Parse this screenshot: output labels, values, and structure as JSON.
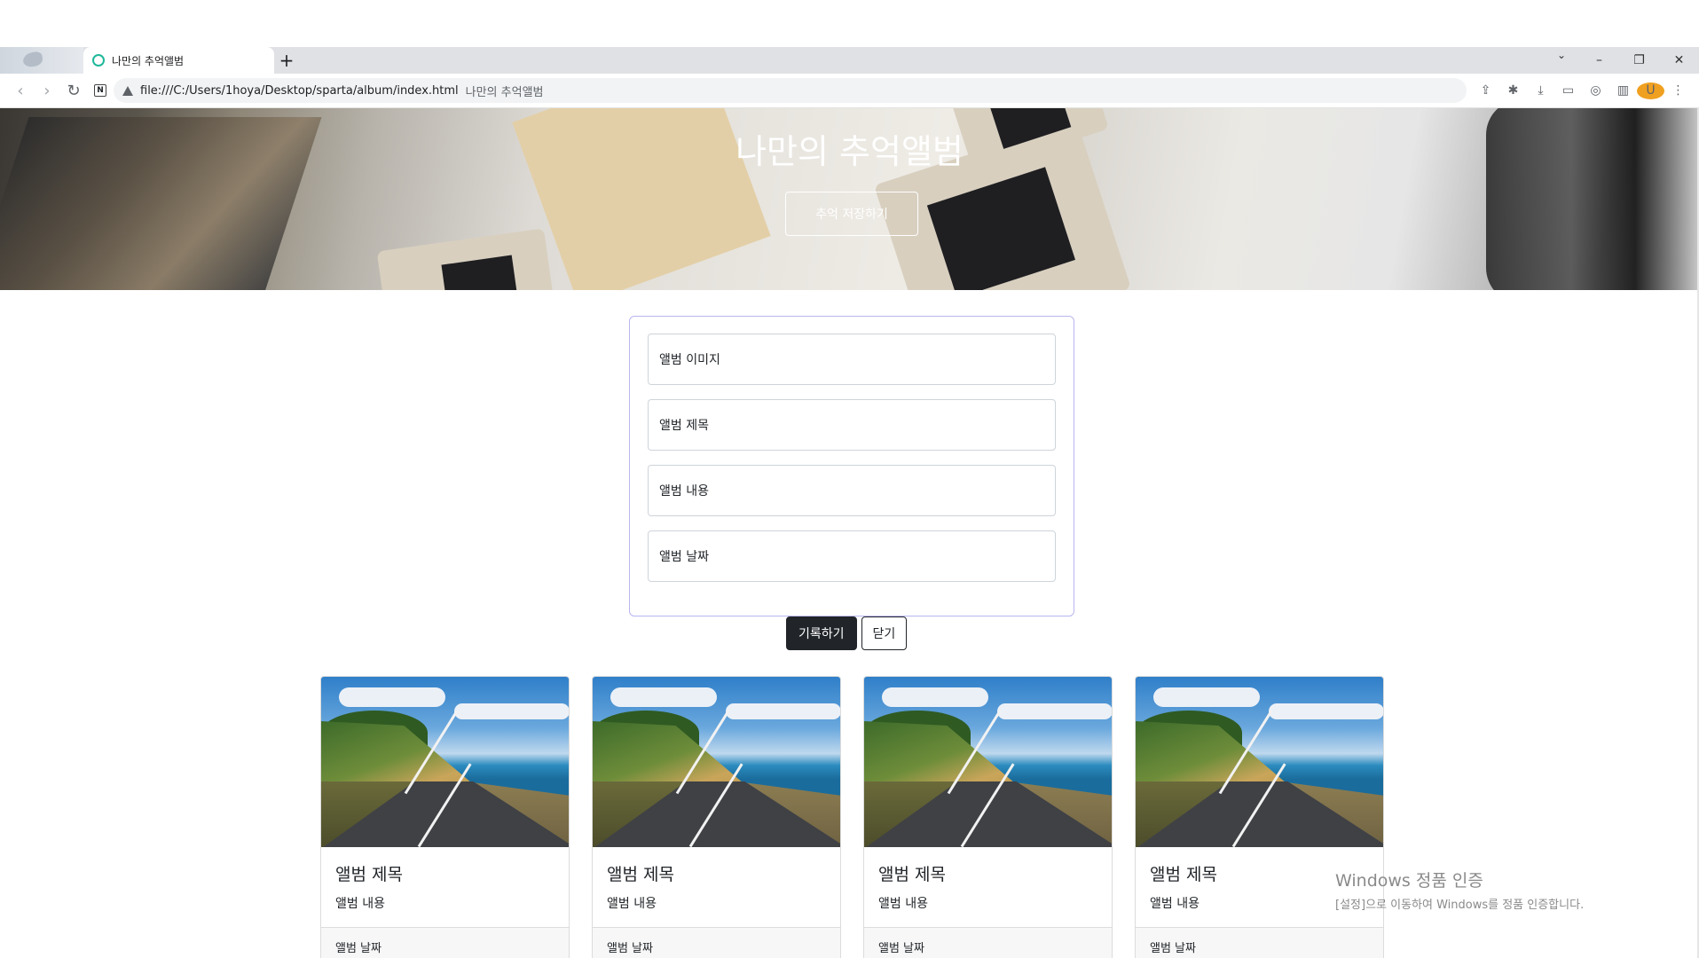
{
  "browser": {
    "tab_title": "나만의 추억앨범",
    "new_tab_label": "+",
    "url": "file:///C:/Users/1hoya/Desktop/sparta/album/index.html",
    "url_page_title": "나만의 추억앨범",
    "profile_initial": "U",
    "window_controls": {
      "dropdown": "⌄",
      "minimize": "–",
      "restore": "❐",
      "close": "✕"
    },
    "nav": {
      "back": "‹",
      "forward": "›",
      "reload": "↻",
      "notion": "N"
    },
    "toolbar_icons": [
      "share-icon",
      "extensions-icon",
      "download-icon",
      "media-icon",
      "screenshot-icon",
      "sidebar-icon"
    ],
    "toolbar_glyphs": [
      "⇪",
      "✱",
      "⤓",
      "▭",
      "◎",
      "▥"
    ],
    "menu_glyph": "⋮"
  },
  "hero": {
    "title": "나만의 추억앨범",
    "button_label": "추억 저장하기"
  },
  "form": {
    "fields": [
      {
        "label": "앨범 이미지"
      },
      {
        "label": "앨범 제목"
      },
      {
        "label": "앨범 내용"
      },
      {
        "label": "앨범 날짜"
      }
    ],
    "submit_label": "기록하기",
    "close_label": "닫기"
  },
  "cards": [
    {
      "title": "앨범 제목",
      "text": "앨범 내용",
      "date": "앨범 날짜"
    },
    {
      "title": "앨범 제목",
      "text": "앨범 내용",
      "date": "앨범 날짜"
    },
    {
      "title": "앨범 제목",
      "text": "앨범 내용",
      "date": "앨범 날짜"
    },
    {
      "title": "앨범 제목",
      "text": "앨범 내용",
      "date": "앨범 날짜"
    }
  ],
  "watermark": {
    "line1": "Windows 정품 인증",
    "line2": "[설정]으로 이동하여 Windows를 정품 인증합니다."
  },
  "colors": {
    "accent_dark": "#212529",
    "form_border": "#b9b6f0",
    "favicon": "#1fb89a"
  }
}
